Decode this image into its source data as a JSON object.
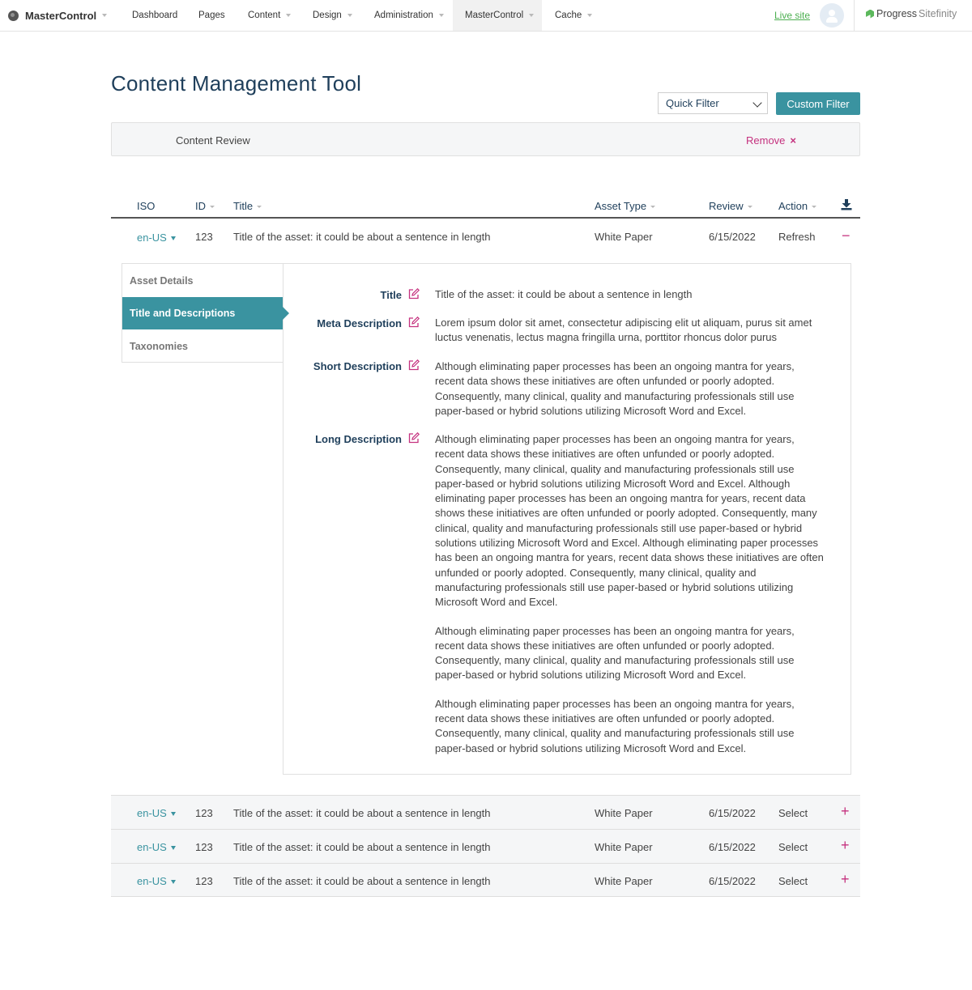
{
  "nav": {
    "brand": "MasterControl",
    "items": [
      {
        "label": "Dashboard",
        "caret": false
      },
      {
        "label": "Pages",
        "caret": false
      },
      {
        "label": "Content",
        "caret": true
      },
      {
        "label": "Design",
        "caret": true
      },
      {
        "label": "Administration",
        "caret": true
      },
      {
        "label": "MasterControl",
        "caret": true,
        "active": true
      },
      {
        "label": "Cache",
        "caret": true
      }
    ],
    "live_site": "Live site",
    "logo_progress": "Progress",
    "logo_sitefinity": "Sitefinity"
  },
  "page": {
    "title": "Content Management Tool",
    "quick_filter": "Quick Filter",
    "custom_filter": "Custom Filter"
  },
  "filter_bar": {
    "label": "Content Review",
    "remove": "Remove",
    "remove_icon": "×"
  },
  "table": {
    "columns": [
      "ISO",
      "ID",
      "Title",
      "Asset Type",
      "Review",
      "Action"
    ],
    "rows": [
      {
        "iso": "en-US",
        "id": "123",
        "title": "Title of the asset: it could be about a sentence in length",
        "asset_type": "White Paper",
        "review": "6/15/2022",
        "action": "Refresh",
        "toggle": "−"
      },
      {
        "iso": "en-US",
        "id": "123",
        "title": "Title of the asset: it could be about a sentence in length",
        "asset_type": "White Paper",
        "review": "6/15/2022",
        "action": "Select",
        "toggle": "+"
      },
      {
        "iso": "en-US",
        "id": "123",
        "title": "Title of the asset: it could be about a sentence in length",
        "asset_type": "White Paper",
        "review": "6/15/2022",
        "action": "Select",
        "toggle": "+"
      },
      {
        "iso": "en-US",
        "id": "123",
        "title": "Title of the asset: it could be about a sentence in length",
        "asset_type": "White Paper",
        "review": "6/15/2022",
        "action": "Select",
        "toggle": "+"
      }
    ]
  },
  "detail": {
    "tabs": [
      "Asset Details",
      "Title and Descriptions",
      "Taxonomies"
    ],
    "fields": {
      "title_label": "Title",
      "title_value": "Title of the asset: it could be about a sentence in length",
      "meta_label": "Meta Description",
      "meta_value": "Lorem ipsum dolor sit amet, consectetur adipiscing elit ut aliquam, purus sit amet luctus venenatis, lectus magna fringilla urna, porttitor rhoncus dolor purus",
      "short_label": "Short Description",
      "short_value": "Although eliminating paper processes has been an ongoing mantra for years, recent data shows these initiatives are often unfunded or poorly adopted. Consequently, many clinical, quality and manufacturing professionals still use paper-based or hybrid solutions utilizing Microsoft Word and Excel.",
      "long_label": "Long Description",
      "long_paragraphs": [
        "Although eliminating paper processes has been an ongoing mantra for years, recent data shows these initiatives are often unfunded or poorly adopted. Consequently, many clinical, quality and manufacturing professionals still use paper-based or hybrid solutions utilizing Microsoft Word and Excel. Although eliminating paper processes has been an ongoing mantra for years, recent data shows these initiatives are often unfunded or poorly adopted. Consequently, many clinical, quality and manufacturing professionals still use paper-based or hybrid solutions utilizing Microsoft Word and Excel. Although eliminating paper processes has been an ongoing mantra for years, recent data shows these initiatives are often unfunded or poorly adopted. Consequently, many clinical, quality and manufacturing professionals still use paper-based or hybrid solutions utilizing Microsoft Word and Excel.",
        "Although eliminating paper processes has been an ongoing mantra for years, recent data shows these initiatives are often unfunded or poorly adopted. Consequently, many clinical, quality and manufacturing professionals still use paper-based or hybrid solutions utilizing Microsoft Word and Excel.",
        "Although eliminating paper processes has been an ongoing mantra for years, recent data shows these initiatives are often unfunded or poorly adopted. Consequently, many clinical, quality and manufacturing professionals still use paper-based or hybrid solutions utilizing Microsoft Word and Excel."
      ]
    }
  },
  "colors": {
    "accent_teal": "#3a93a0",
    "accent_magenta": "#c5327f",
    "heading_navy": "#1f3f5b",
    "live_site_green": "#4caf50"
  },
  "icons": {
    "brand": "globe-icon",
    "user": "user-avatar-icon",
    "download": "download-icon",
    "edit": "edit-icon",
    "remove": "close-icon",
    "expand": "plus-icon",
    "collapse": "minus-icon"
  }
}
